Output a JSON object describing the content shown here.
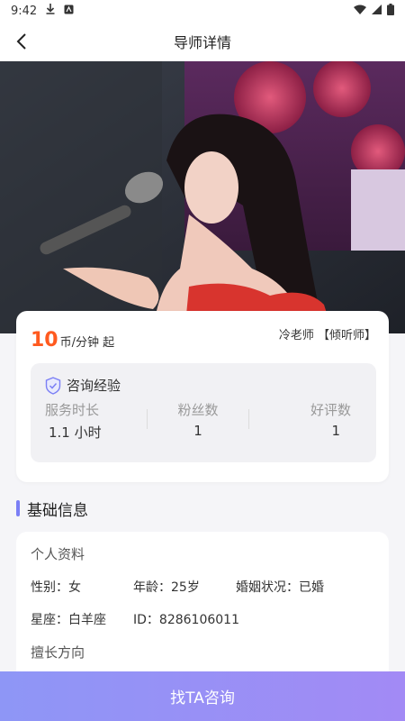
{
  "status_bar": {
    "time": "9:42"
  },
  "nav": {
    "title": "导师详情"
  },
  "hero": {
    "alt": ""
  },
  "pricing": {
    "amount": "10",
    "unit": "币/分钟 起"
  },
  "teacher": {
    "name_role": "冷老师 【倾听师】"
  },
  "experience": {
    "title": "咨询经验",
    "stats": [
      {
        "label": "服务时长",
        "value": "1.1 小时"
      },
      {
        "label": "粉丝数",
        "value": "1"
      },
      {
        "label": "好评数",
        "value": "1"
      }
    ]
  },
  "basic_info": {
    "section_title": "基础信息",
    "profile_title": "个人资料",
    "gender": "性别：女",
    "age": "年龄：25岁",
    "marital": "婚姻状况：已婚",
    "zodiac": "星座：白羊座",
    "id": "ID：8286106011",
    "expertise_title": "擅长方向"
  },
  "cta": {
    "label": "找TA咨询"
  },
  "colors": {
    "accent": "#8e96f6",
    "price": "#ff5a1f"
  }
}
